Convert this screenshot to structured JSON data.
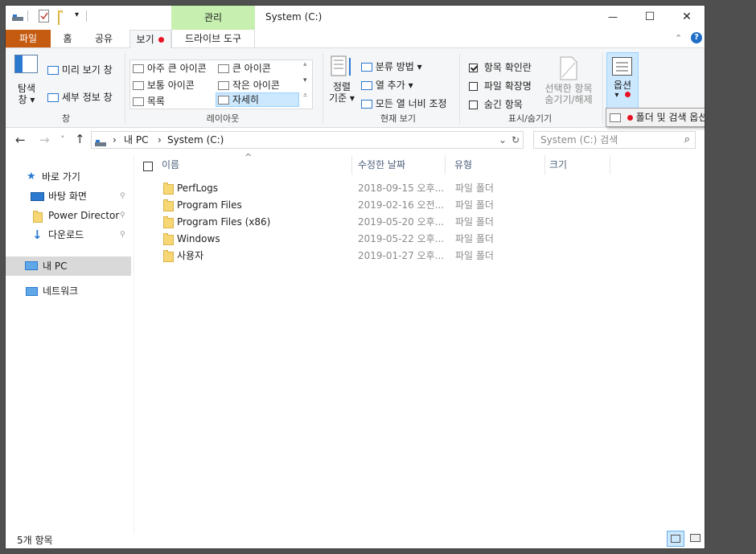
{
  "title_bar": {
    "context_tab": "관리",
    "window_title": "System (C:)",
    "min_glyph": "—",
    "max_glyph": "☐",
    "close_glyph": "✕"
  },
  "ribbon_tabs": {
    "file": "파일",
    "home": "홈",
    "share": "공유",
    "view": "보기",
    "drive_tools": "드라이브 도구"
  },
  "ribbon": {
    "panes": {
      "navigation_pane": "탐색\n창 ▾",
      "preview_pane": "미리 보기 창",
      "details_pane": "세부 정보 창",
      "group": "창"
    },
    "layout": {
      "extra_large_icons": "아주 큰 아이콘",
      "large_icons": "큰 아이콘",
      "medium_icons": "보통 아이콘",
      "small_icons": "작은 아이콘",
      "list": "목록",
      "details": "자세히",
      "group": "레이아웃"
    },
    "current_view": {
      "sort_by": "정렬\n기준 ▾",
      "group_by": "분류 방법 ▾",
      "add_columns": "열 추가 ▾",
      "size_all_columns": "모든 열 너비 조정",
      "group": "현재 보기"
    },
    "show_hide": {
      "item_checkboxes": "항목 확인란",
      "item_checkboxes_checked": true,
      "file_extensions": "파일 확장명",
      "file_extensions_checked": false,
      "hidden_items": "숨긴 항목",
      "hidden_items_checked": false,
      "hide_selected": "선택한 항목\n숨기기/해제",
      "group": "표시/숨기기"
    },
    "options": {
      "label": "옵션",
      "arrow": "▾",
      "dropdown_item": "폴더 및 검색 옵션 변경(O)"
    }
  },
  "address_bar": {
    "back": "←",
    "forward": "→",
    "recent": "˅",
    "up": "↑",
    "crumbs": [
      "내 PC",
      "System (C:)"
    ],
    "separator": "›",
    "dropdown": "⌄",
    "refresh": "↻",
    "search_placeholder": "System (C:) 검색",
    "search_glyph": "⌕"
  },
  "nav_pane": {
    "quick_access": "바로 가기",
    "desktop": "바탕 화면",
    "power_director": "Power Director",
    "downloads": "다운로드",
    "this_pc": "내 PC",
    "network": "네트워크",
    "pin_glyph": "📌"
  },
  "columns": {
    "name": "이름",
    "date": "수정한 날짜",
    "type": "유형",
    "size": "크기",
    "sort_glyph": "^"
  },
  "files": [
    {
      "name": "PerfLogs",
      "date": "2018-09-15 오후...",
      "type": "파일 폴더"
    },
    {
      "name": "Program Files",
      "date": "2019-02-16 오전...",
      "type": "파일 폴더"
    },
    {
      "name": "Program Files (x86)",
      "date": "2019-05-20 오후...",
      "type": "파일 폴더"
    },
    {
      "name": "Windows",
      "date": "2019-05-22 오후...",
      "type": "파일 폴더"
    },
    {
      "name": "사용자",
      "date": "2019-01-27 오후...",
      "type": "파일 폴더"
    }
  ],
  "status_bar": {
    "item_count": "5개 항목"
  },
  "colors": {
    "file_tab": "#c55a11",
    "context_tab": "#c6efb0",
    "selection": "#cce8ff",
    "marker": "#e81123",
    "nav_selected": "#d9d9d9",
    "help_badge": "#1e6ec8"
  }
}
